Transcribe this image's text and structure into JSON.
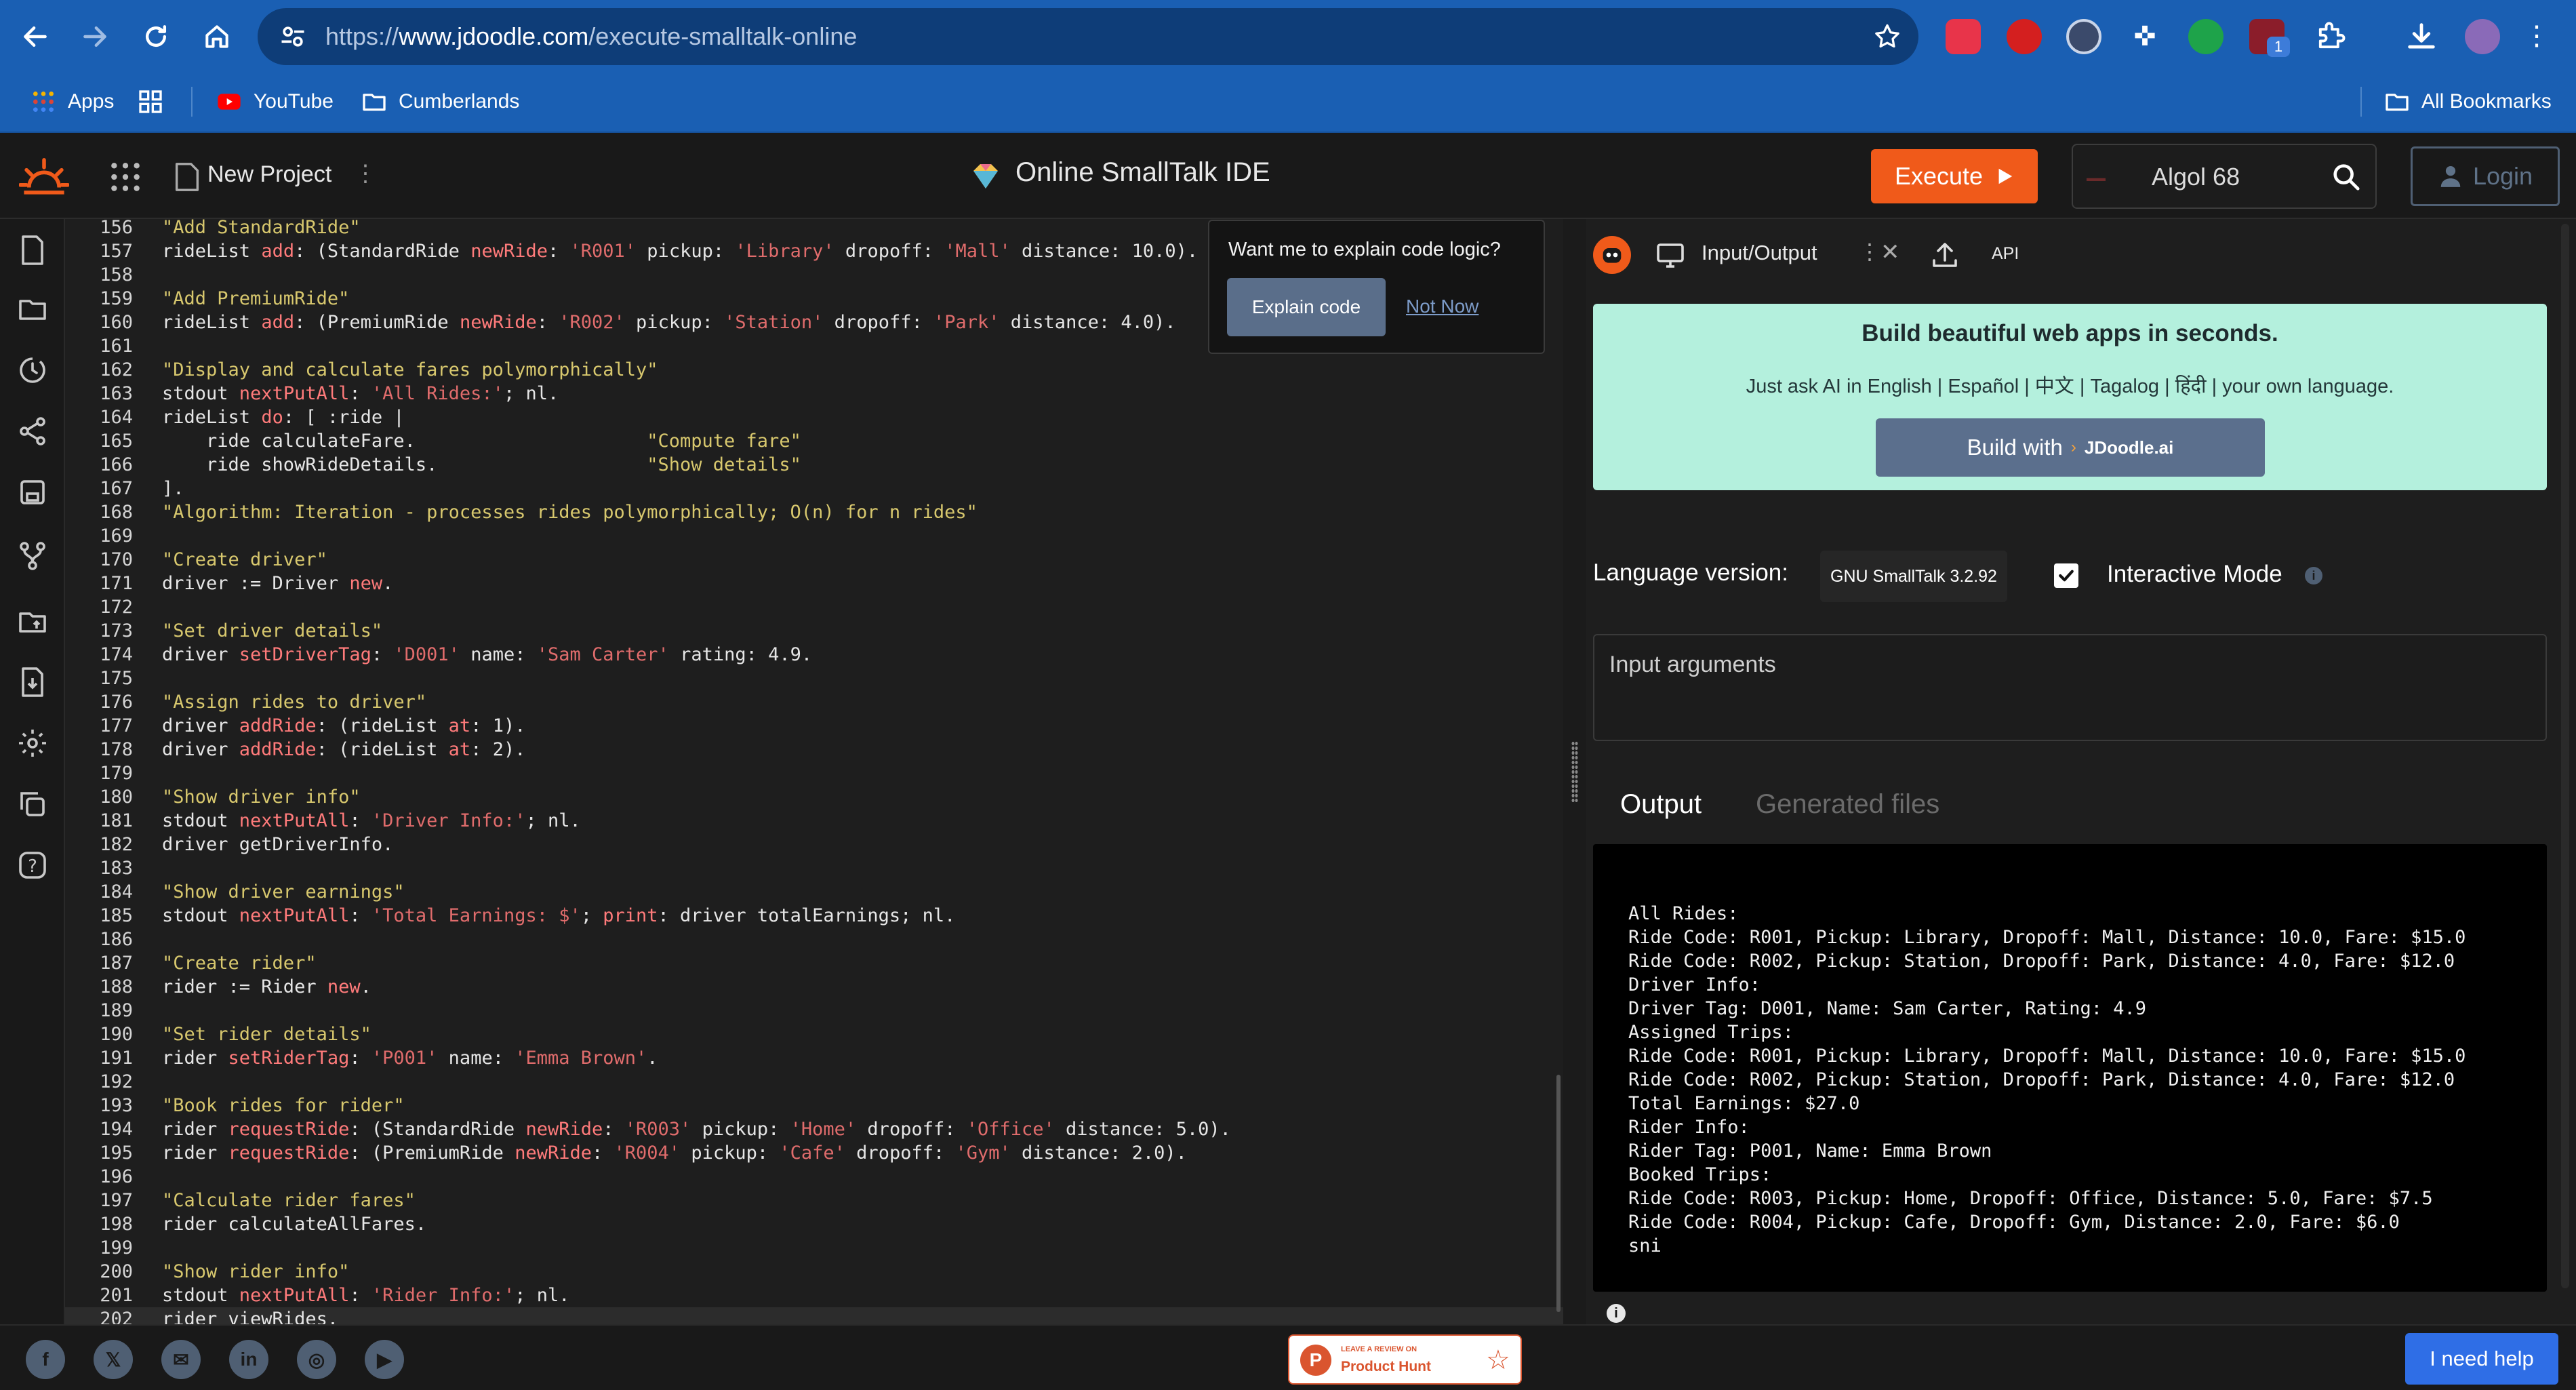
{
  "browser": {
    "url_prefix": "https://",
    "url_domain": "www.jdoodle.com",
    "url_path": "/execute-smalltalk-online",
    "bookmarks": [
      "Apps",
      "YouTube",
      "Cumberlands"
    ],
    "all_bookmarks": "All Bookmarks",
    "extension_badge": "1"
  },
  "header": {
    "new_project": "New Project",
    "title": "Online SmallTalk IDE",
    "execute_label": "Execute",
    "language_select": "Algol 68",
    "login_label": "Login"
  },
  "tooltip": {
    "question": "Want me to explain code logic?",
    "explain_label": "Explain code",
    "not_now_label": "Not Now"
  },
  "editor": {
    "lines": [
      {
        "n": "156",
        "t": "\"Add StandardRide\""
      },
      {
        "n": "157",
        "t": "rideList add: (StandardRide newRide: 'R001' pickup: 'Library' dropoff: 'Mall' distance: 10.0)."
      },
      {
        "n": "158",
        "t": ""
      },
      {
        "n": "159",
        "t": "\"Add PremiumRide\""
      },
      {
        "n": "160",
        "t": "rideList add: (PremiumRide newRide: 'R002' pickup: 'Station' dropoff: 'Park' distance: 4.0)."
      },
      {
        "n": "161",
        "t": ""
      },
      {
        "n": "162",
        "t": "\"Display and calculate fares polymorphically\""
      },
      {
        "n": "163",
        "t": "stdout nextPutAll: 'All Rides:'; nl."
      },
      {
        "n": "164",
        "t": "rideList do: [ :ride |"
      },
      {
        "n": "165",
        "t": "    ride calculateFare.                     \"Compute fare\""
      },
      {
        "n": "166",
        "t": "    ride showRideDetails.                   \"Show details\""
      },
      {
        "n": "167",
        "t": "]."
      },
      {
        "n": "168",
        "t": "\"Algorithm: Iteration - processes rides polymorphically; O(n) for n rides\""
      },
      {
        "n": "169",
        "t": ""
      },
      {
        "n": "170",
        "t": "\"Create driver\""
      },
      {
        "n": "171",
        "t": "driver := Driver new."
      },
      {
        "n": "172",
        "t": ""
      },
      {
        "n": "173",
        "t": "\"Set driver details\""
      },
      {
        "n": "174",
        "t": "driver setDriverTag: 'D001' name: 'Sam Carter' rating: 4.9."
      },
      {
        "n": "175",
        "t": ""
      },
      {
        "n": "176",
        "t": "\"Assign rides to driver\""
      },
      {
        "n": "177",
        "t": "driver addRide: (rideList at: 1)."
      },
      {
        "n": "178",
        "t": "driver addRide: (rideList at: 2)."
      },
      {
        "n": "179",
        "t": ""
      },
      {
        "n": "180",
        "t": "\"Show driver info\""
      },
      {
        "n": "181",
        "t": "stdout nextPutAll: 'Driver Info:'; nl."
      },
      {
        "n": "182",
        "t": "driver getDriverInfo."
      },
      {
        "n": "183",
        "t": ""
      },
      {
        "n": "184",
        "t": "\"Show driver earnings\""
      },
      {
        "n": "185",
        "t": "stdout nextPutAll: 'Total Earnings: $'; print: driver totalEarnings; nl."
      },
      {
        "n": "186",
        "t": ""
      },
      {
        "n": "187",
        "t": "\"Create rider\""
      },
      {
        "n": "188",
        "t": "rider := Rider new."
      },
      {
        "n": "189",
        "t": ""
      },
      {
        "n": "190",
        "t": "\"Set rider details\""
      },
      {
        "n": "191",
        "t": "rider setRiderTag: 'P001' name: 'Emma Brown'."
      },
      {
        "n": "192",
        "t": ""
      },
      {
        "n": "193",
        "t": "\"Book rides for rider\""
      },
      {
        "n": "194",
        "t": "rider requestRide: (StandardRide newRide: 'R003' pickup: 'Home' dropoff: 'Office' distance: 5.0)."
      },
      {
        "n": "195",
        "t": "rider requestRide: (PremiumRide newRide: 'R004' pickup: 'Cafe' dropoff: 'Gym' distance: 2.0)."
      },
      {
        "n": "196",
        "t": ""
      },
      {
        "n": "197",
        "t": "\"Calculate rider fares\""
      },
      {
        "n": "198",
        "t": "rider calculateAllFares."
      },
      {
        "n": "199",
        "t": ""
      },
      {
        "n": "200",
        "t": "\"Show rider info\""
      },
      {
        "n": "201",
        "t": "stdout nextPutAll: 'Rider Info:'; nl."
      },
      {
        "n": "202",
        "t": "rider viewRides."
      }
    ]
  },
  "io_panel": {
    "tab_label": "Input/Output",
    "api_label": "API",
    "promo_title": "Build beautiful web apps in seconds.",
    "promo_text": "Just ask AI in English | Español | 中文 | Tagalog | हिंदी | your own language.",
    "build_label": "Build with",
    "build_brand": "JDoodle.ai",
    "language_version_label": "Language version:",
    "language_version_value": "GNU SmallTalk 3.2.92",
    "interactive_mode_label": "Interactive Mode",
    "interactive_mode_checked": true,
    "input_placeholder": "Input arguments",
    "output_tab": "Output",
    "generated_files_tab": "Generated files",
    "output_lines": [
      "All Rides:",
      "Ride Code: R001, Pickup: Library, Dropoff: Mall, Distance: 10.0, Fare: $15.0",
      "Ride Code: R002, Pickup: Station, Dropoff: Park, Distance: 4.0, Fare: $12.0",
      "Driver Info:",
      "Driver Tag: D001, Name: Sam Carter, Rating: 4.9",
      "Assigned Trips:",
      "Ride Code: R001, Pickup: Library, Dropoff: Mall, Distance: 10.0, Fare: $15.0",
      "Ride Code: R002, Pickup: Station, Dropoff: Park, Distance: 4.0, Fare: $12.0",
      "Total Earnings: $27.0",
      "Rider Info:",
      "Rider Tag: P001, Name: Emma Brown",
      "Booked Trips:",
      "Ride Code: R003, Pickup: Home, Dropoff: Office, Distance: 5.0, Fare: $7.5",
      "Ride Code: R004, Pickup: Cafe, Dropoff: Gym, Distance: 2.0, Fare: $6.0",
      "sni"
    ]
  },
  "footer": {
    "product_hunt_top": "LEAVE A REVIEW ON",
    "product_hunt_name": "Product Hunt",
    "help_label": "I need help"
  },
  "colors": {
    "chrome_blue": "#1a5fb3",
    "execute_orange": "#f05a1a",
    "promo_mint": "#b4f0dd",
    "help_blue": "#2f6ee6",
    "string_red": "#e06c6c",
    "comment_yellow": "#d8c86e"
  }
}
